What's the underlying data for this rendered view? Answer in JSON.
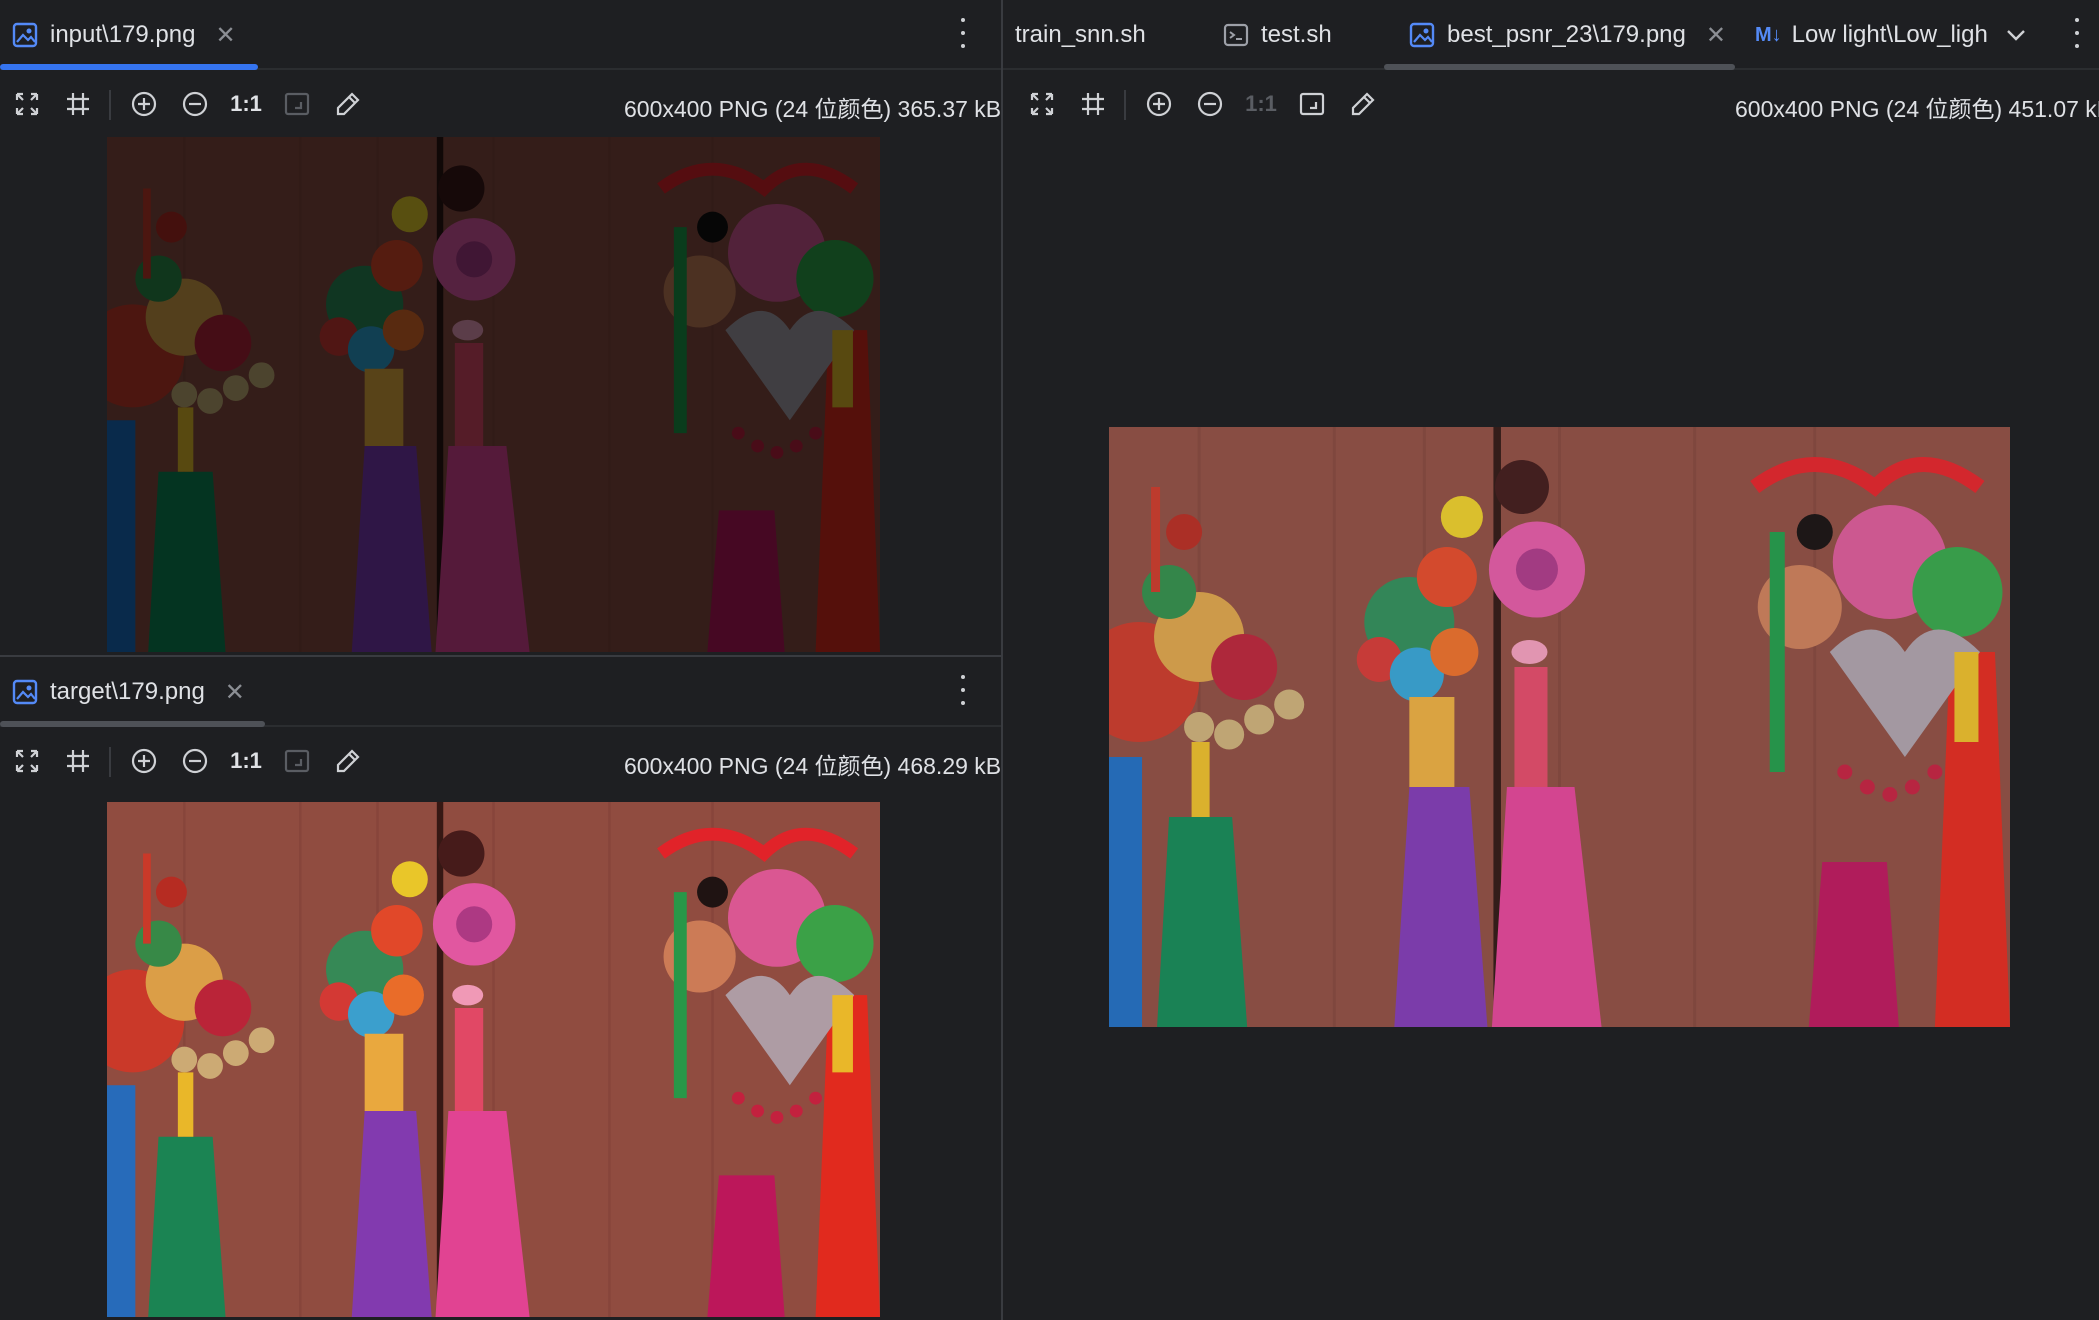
{
  "top_left": {
    "tab": {
      "label": "input\\179.png",
      "icon": "image-file-icon"
    },
    "info": "600x400 PNG (24 位颜色) 365.37 kB"
  },
  "bottom_left": {
    "tab": {
      "label": "target\\179.png",
      "icon": "image-file-icon"
    },
    "info": "600x400 PNG (24 位颜色) 468.29 kB"
  },
  "right": {
    "tabs": [
      {
        "label": "train_snn.sh",
        "icon": ""
      },
      {
        "label": "test.sh",
        "icon": "terminal-icon"
      },
      {
        "label": "best_psnr_23\\179.png",
        "icon": "image-file-icon",
        "active": true
      },
      {
        "label": "Low light\\Low_ligh",
        "icon": "markdown-icon",
        "icon_text": "M↓"
      }
    ],
    "info": "600x400 PNG (24 位颜色) 451.07 kB"
  },
  "toolbar": {
    "zoom_actual_label": "1:1"
  },
  "colors": {
    "background": "#1e1f22",
    "accent": "#3574f0",
    "tab_underline_inactive": "#4e5157"
  }
}
